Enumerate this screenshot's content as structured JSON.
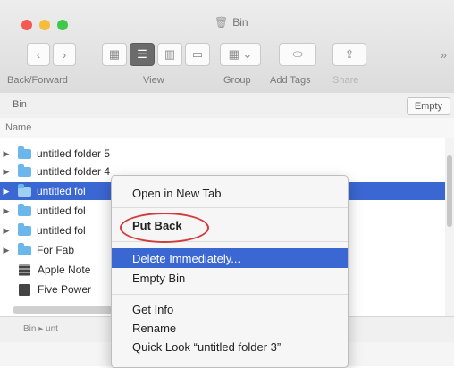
{
  "window": {
    "title": "Bin"
  },
  "toolbar": {
    "back_icon": "chevron-left",
    "forward_icon": "chevron-right",
    "labels": {
      "back_forward": "Back/Forward",
      "view": "View",
      "group": "Group",
      "add_tags": "Add Tags",
      "share": "Share"
    },
    "overflow": "»"
  },
  "pathbar": {
    "title": "Bin",
    "empty_button": "Empty"
  },
  "columns": {
    "name": "Name"
  },
  "files": [
    {
      "name": "untitled folder 5",
      "kind": "folder"
    },
    {
      "name": "untitled folder 4",
      "kind": "folder"
    },
    {
      "name": "untitled fol",
      "kind": "folder",
      "selected": true
    },
    {
      "name": "untitled fol",
      "kind": "folder"
    },
    {
      "name": "untitled fol",
      "kind": "folder"
    },
    {
      "name": "For Fab",
      "kind": "folder"
    },
    {
      "name": "Apple Note",
      "kind": "doc"
    },
    {
      "name": "Five Power",
      "kind": "doc"
    }
  ],
  "bottom_path": {
    "text": "Bin ▸ unt"
  },
  "context_menu": {
    "items": [
      "Open in New Tab",
      "Put Back",
      "Delete Immediately...",
      "Empty Bin",
      "Get Info",
      "Rename",
      "Quick Look “untitled folder 3”"
    ],
    "highlighted": "Delete Immediately...",
    "annotated": "Put Back",
    "annotation_color": "#d43a3a"
  },
  "colors": {
    "selection": "#3b67d3",
    "folder": "#6bb7ec"
  }
}
